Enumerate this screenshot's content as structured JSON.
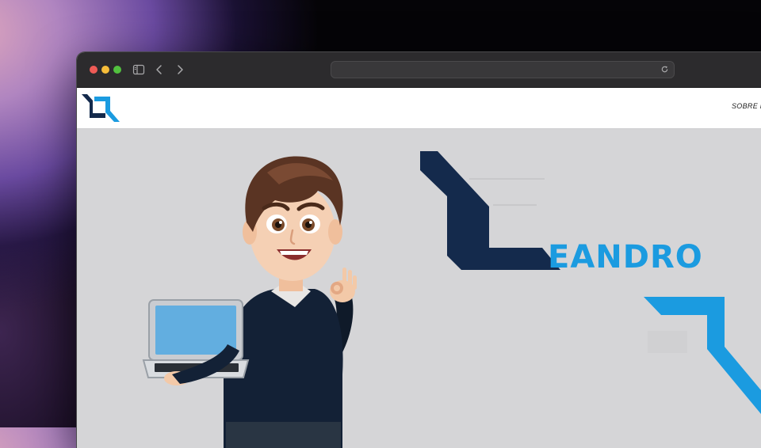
{
  "browser": {
    "url": "",
    "icons": [
      "sidebar-icon",
      "back-icon",
      "forward-icon",
      "reload-icon"
    ]
  },
  "site": {
    "nav": {
      "first_item": "SOBRE M"
    },
    "hero": {
      "brand_name": "EANDRO"
    }
  },
  "colors": {
    "brand_navy": "#142a4c",
    "brand_blue": "#1b9be0",
    "page_bg": "#d5d5d7",
    "titlebar": "#2c2b2d"
  }
}
